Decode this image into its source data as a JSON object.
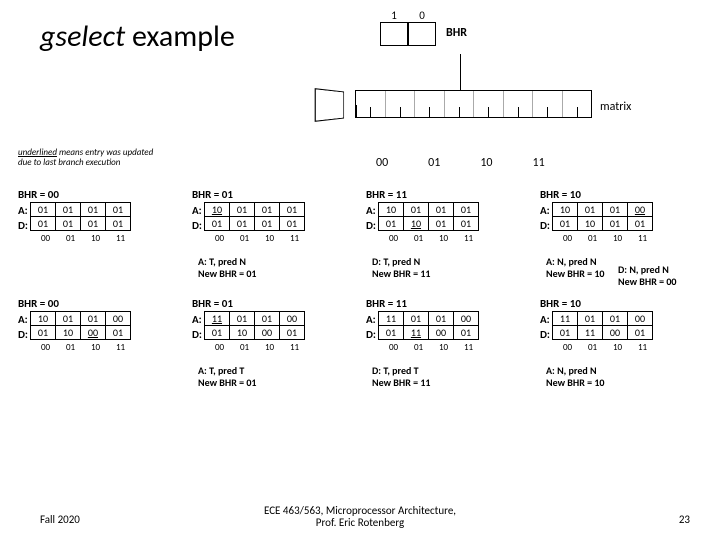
{
  "title_italic": "gselect",
  "title_rest": " example",
  "bhr": {
    "bits": [
      "1",
      "0"
    ],
    "label": "BHR"
  },
  "matrix_label": "matrix",
  "note_underlined": "underlined",
  "note_rest": " means entry was updated due to last branch execution",
  "idx": [
    "00",
    "01",
    "10",
    "11"
  ],
  "cols": [
    "00",
    "01",
    "10",
    "11"
  ],
  "row_labels": [
    "A:",
    "D:"
  ],
  "panels": [
    {
      "hdr": "BHR = 00",
      "A": [
        "01",
        "01",
        "01",
        "01"
      ],
      "D": [
        "01",
        "01",
        "01",
        "01"
      ],
      "u": [],
      "cap": ""
    },
    {
      "hdr": "BHR = 01",
      "A": [
        "10",
        "01",
        "01",
        "01"
      ],
      "D": [
        "01",
        "01",
        "01",
        "01"
      ],
      "u": [
        "A0"
      ],
      "cap": "A: T, pred N\nNew BHR = 01"
    },
    {
      "hdr": "BHR = 11",
      "A": [
        "10",
        "01",
        "01",
        "01"
      ],
      "D": [
        "01",
        "10",
        "01",
        "01"
      ],
      "u": [
        "D1"
      ],
      "cap": "D: T, pred N\nNew BHR = 11"
    },
    {
      "hdr": "BHR = 10",
      "A": [
        "10",
        "01",
        "01",
        "00"
      ],
      "D": [
        "01",
        "10",
        "01",
        "01"
      ],
      "u": [
        "A3"
      ],
      "cap": "A: N, pred N\nNew BHR = 10"
    },
    {
      "hdr": "BHR = 00",
      "A": [
        "10",
        "01",
        "01",
        "00"
      ],
      "D": [
        "01",
        "10",
        "00",
        "01"
      ],
      "u": [
        "D2"
      ],
      "cap": ""
    },
    {
      "hdr": "BHR = 01",
      "A": [
        "11",
        "01",
        "01",
        "00"
      ],
      "D": [
        "01",
        "10",
        "00",
        "01"
      ],
      "u": [
        "A0"
      ],
      "cap": "A: T, pred T\nNew BHR = 01"
    },
    {
      "hdr": "BHR = 11",
      "A": [
        "11",
        "01",
        "01",
        "00"
      ],
      "D": [
        "01",
        "11",
        "00",
        "01"
      ],
      "u": [
        "D1"
      ],
      "cap": "D: T, pred T\nNew BHR = 11"
    },
    {
      "hdr": "BHR = 10",
      "A": [
        "11",
        "01",
        "01",
        "00"
      ],
      "D": [
        "01",
        "11",
        "00",
        "01"
      ],
      "u": [],
      "cap": "A: N, pred N\nNew BHR = 10"
    }
  ],
  "extra_cap": "D: N, pred N\nNew BHR = 00",
  "footer": {
    "left": "Fall 2020",
    "center": "ECE 463/563, Microprocessor Architecture,\nProf. Eric Rotenberg",
    "right": "23"
  }
}
